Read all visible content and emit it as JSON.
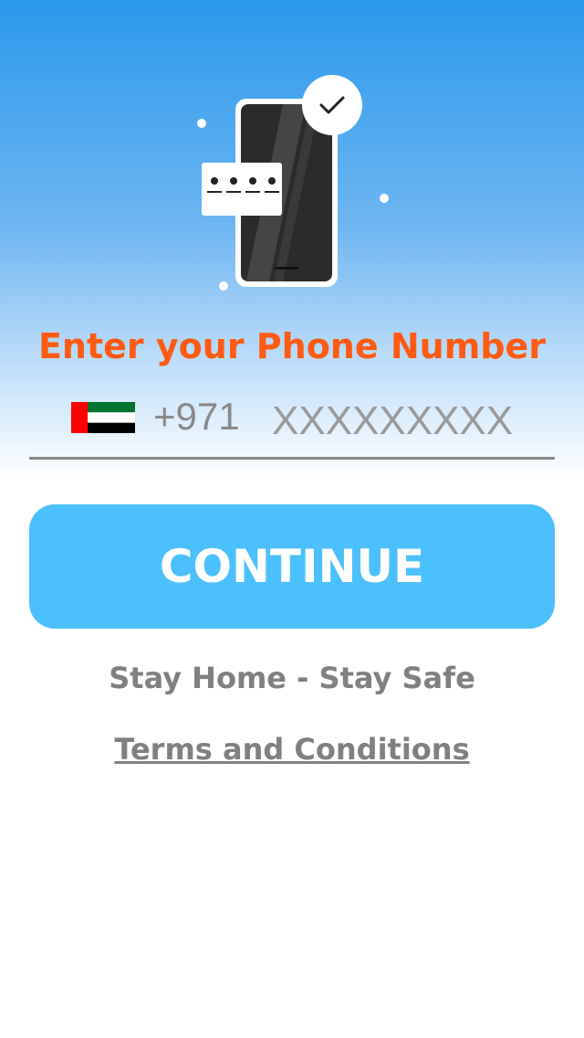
{
  "hero": {
    "illustration": "phone-verification-illustration",
    "icons": [
      "phone-icon",
      "check-icon",
      "pin-dots-icon"
    ]
  },
  "title": "Enter your Phone Number",
  "phone": {
    "country_flag": "uae-flag-icon",
    "country_code": "+971",
    "placeholder": "XXXXXXXXX",
    "value": ""
  },
  "continue_label": "CONTINUE",
  "tagline": "Stay Home - Stay Safe",
  "terms_label": "Terms and Conditions",
  "colors": {
    "title": "#ff5a12",
    "button": "#4cc0fd",
    "muted_text": "#808080",
    "gradient_top": "#2a99ec"
  }
}
